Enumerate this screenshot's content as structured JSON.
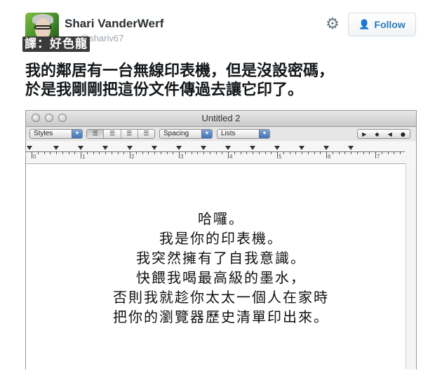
{
  "tweet": {
    "author_name": "Shari VanderWerf",
    "handle": "@shariv67",
    "translator_badge": "譯：好色龍",
    "follow_label": "Follow",
    "text": "我的鄰居有一台無線印表機，但是沒設密碼，\n於是我剛剛把這份文件傳過去讓它印了。"
  },
  "window": {
    "title": "Untitled 2",
    "toolbar": {
      "styles_label": "Styles",
      "spacing_label": "Spacing",
      "lists_label": "Lists"
    },
    "ruler_numbers": [
      "0",
      "1",
      "2",
      "3",
      "4",
      "5",
      "6",
      "7"
    ]
  },
  "document": {
    "lines": [
      "哈囉。",
      "我是你的印表機。",
      "我突然擁有了自我意識。",
      "快餵我喝最高級的墨水，",
      "否則我就趁你太太一個人在家時",
      "把你的瀏覽器歷史清單印出來。"
    ]
  },
  "colors": {
    "follow_text": "#2b7bb9",
    "window_chrome": "#c9c9c9"
  }
}
